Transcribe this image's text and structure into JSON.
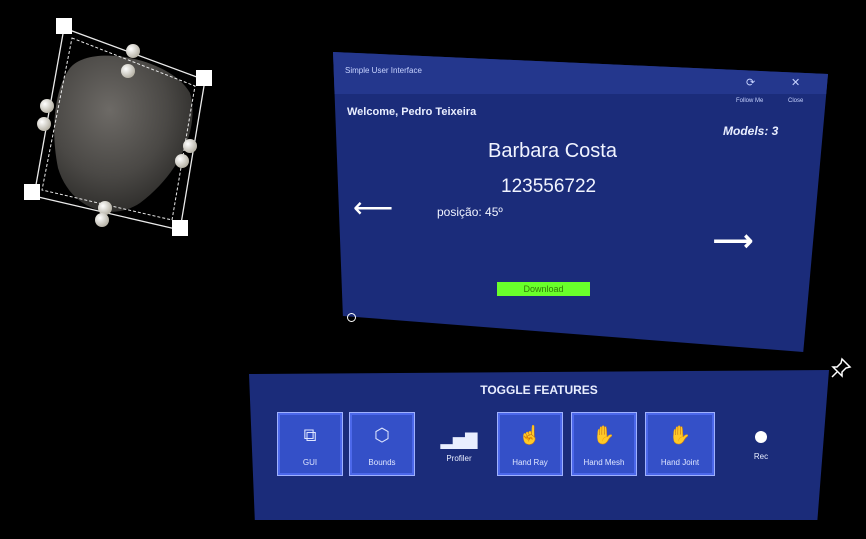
{
  "main_panel": {
    "title": "Simple User Interface",
    "follow_label": "Follow Me",
    "close_label": "Close",
    "welcome": "Welcome, Pedro Teixeira",
    "models": "Models: 3",
    "name": "Barbara Costa",
    "id_number": "123556722",
    "posicao": "posição: 45º",
    "download": "Download",
    "arrow_left": "⟵",
    "arrow_right": "⟶"
  },
  "toggle_panel": {
    "title": "TOGGLE FEATURES",
    "buttons": [
      {
        "label": "GUI",
        "icon": "gui-icon"
      },
      {
        "label": "Bounds",
        "icon": "cube-icon"
      },
      {
        "label": "Profiler",
        "icon": "profiler-icon"
      },
      {
        "label": "Hand Ray",
        "icon": "hand-ray-icon"
      },
      {
        "label": "Hand Mesh",
        "icon": "hand-mesh-icon"
      },
      {
        "label": "Hand Joint",
        "icon": "hand-joint-icon"
      },
      {
        "label": "Rec",
        "icon": "record-icon"
      }
    ],
    "glyphs": {
      "gui": "⧉",
      "bounds": "⬡",
      "profiler": "▂▅▇",
      "hand_ray": "☝",
      "hand_mesh": "✋",
      "hand_joint": "✋"
    }
  },
  "colors": {
    "panel": "#1b2c7a",
    "button": "#3450c8",
    "download": "#69ff2b"
  }
}
